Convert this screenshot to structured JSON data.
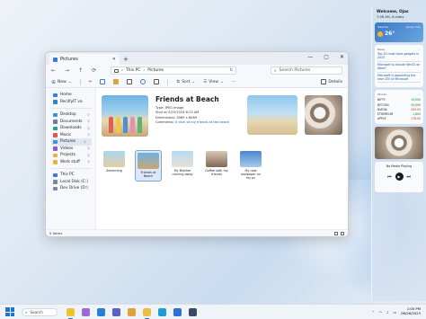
{
  "explorer": {
    "tab_title": "Pictures",
    "address": {
      "segments": [
        "This PC",
        "Pictures"
      ],
      "separator": ">"
    },
    "search_placeholder": "Search Pictures",
    "toolbar": {
      "new": "New",
      "sort": "Sort",
      "view": "View",
      "details": "Details"
    },
    "sidebar": {
      "top": [
        {
          "label": "Home",
          "icon": "home-icon",
          "color": "#3a7bd5"
        },
        {
          "label": "RecilfyIT va",
          "icon": "cloud-icon",
          "color": "#2b88d8"
        }
      ],
      "quick": [
        {
          "label": "Desktop",
          "icon": "desktop-icon",
          "color": "#3d8ee0"
        },
        {
          "label": "Documents",
          "icon": "documents-icon",
          "color": "#6b7f99"
        },
        {
          "label": "Downloads",
          "icon": "downloads-icon",
          "color": "#2a9d8f"
        },
        {
          "label": "Music",
          "icon": "music-icon",
          "color": "#e0584a"
        },
        {
          "label": "Pictures",
          "icon": "pictures-icon",
          "color": "#3a8fd9",
          "selected": true
        },
        {
          "label": "Videos",
          "icon": "videos-icon",
          "color": "#8a5cc4"
        },
        {
          "label": "Projects",
          "icon": "folder-icon",
          "color": "#e8b33a"
        },
        {
          "label": "Work stuff",
          "icon": "folder-icon",
          "color": "#e8b33a"
        }
      ],
      "devices": [
        {
          "label": "This PC",
          "icon": "pc-icon",
          "color": "#3a7bd5"
        },
        {
          "label": "Local Disk (C:)",
          "icon": "drive-icon",
          "color": "#7a8699"
        },
        {
          "label": "Dev Drive (D:)",
          "icon": "drive-icon",
          "color": "#7a8699"
        }
      ]
    },
    "preview": {
      "title": "Friends at Beach",
      "type": "Type: JPEG Image",
      "shot": "Shot at 5/25/2024 6:23 AM",
      "dimensions": "Dimensions: 3089 x 6069",
      "comments_label": "Comments:",
      "comments_link": "A click of my friends at the beach"
    },
    "thumbnails": [
      {
        "label": "Swimming",
        "colors": [
          "#a9d6f0",
          "#e2cfa2"
        ]
      },
      {
        "label": "Friends at Beach",
        "colors": [
          "#6fb3e0",
          "#c8a675"
        ],
        "selected": true
      },
      {
        "label": "My Brother running away",
        "colors": [
          "#b6dbf2",
          "#e8e1d6"
        ]
      },
      {
        "label": "Coffee with my friends",
        "colors": [
          "#d9c7b3",
          "#7f6a57"
        ]
      },
      {
        "label": "My new wallpaper on my pc",
        "colors": [
          "#4a86d0",
          "#a7c9ec"
        ]
      }
    ],
    "status": "5 items"
  },
  "widgets": {
    "welcome": "Welcome, Ojas",
    "datetime": "7:08 AM, Sunday",
    "weather": {
      "label": "Weather",
      "location": "Jersey City",
      "temp": "26°"
    },
    "news": {
      "label": "News",
      "items": [
        "Top 10 must have gadgets in 2023",
        "Microsoft to include Win32 on Xbox?",
        "Microsoft is appointing the new CEO of Microsoft"
      ]
    },
    "stocks": {
      "label": "Stocks",
      "rows": [
        {
          "name": "NIFTY",
          "value": "19,000",
          "dir": "up"
        },
        {
          "name": "BITCOIN",
          "value": "29,000",
          "dir": "up"
        },
        {
          "name": "NVIDIA",
          "value": "430.00",
          "dir": "down"
        },
        {
          "name": "ETHEREUM",
          "value": "1,800",
          "dir": "up"
        },
        {
          "name": "APPLE",
          "value": "178.00",
          "dir": "down"
        }
      ]
    },
    "media": {
      "title": "No Media Playing"
    }
  },
  "taskbar": {
    "search": "Search",
    "apps": [
      {
        "icon": "explorer-icon",
        "color": "#f1c232",
        "active": true
      },
      {
        "icon": "copilot-icon",
        "color": "#9b6cd6"
      },
      {
        "icon": "store-icon",
        "color": "#2a7fd4"
      },
      {
        "icon": "teams-icon",
        "color": "#5b5fc7"
      },
      {
        "icon": "photos-icon",
        "color": "#e1a23b"
      },
      {
        "icon": "folder-icon",
        "color": "#f0bd4a",
        "active": true
      },
      {
        "icon": "edge-icon",
        "color": "#1f9bd8"
      },
      {
        "icon": "mail-icon",
        "color": "#2f6fd6"
      },
      {
        "icon": "store-bag-icon",
        "color": "#3a4a63"
      }
    ],
    "time": "1:00 PM",
    "date": "06/26/2023"
  }
}
